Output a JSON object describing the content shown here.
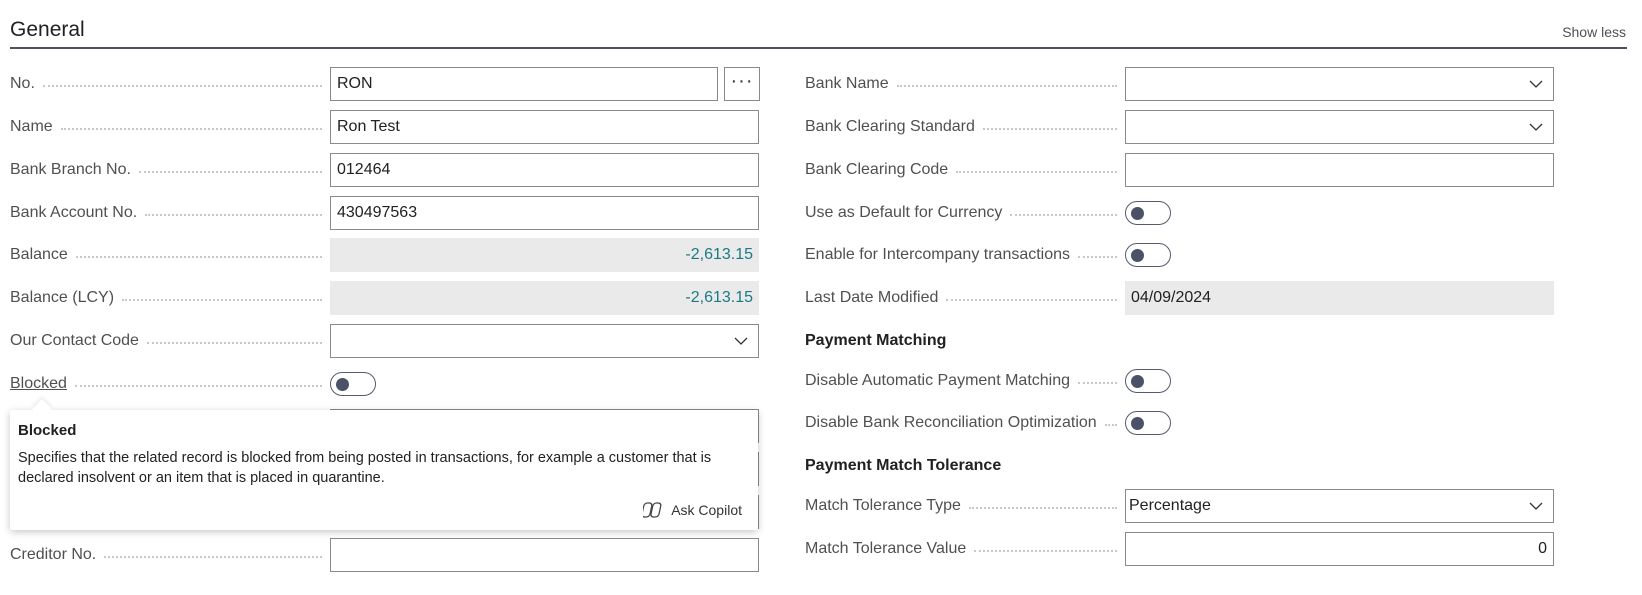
{
  "header": {
    "title": "General",
    "show_less": "Show less"
  },
  "left": {
    "no": {
      "label": "No.",
      "value": "RON",
      "assist": "···"
    },
    "name": {
      "label": "Name",
      "value": "Ron Test"
    },
    "branch": {
      "label": "Bank Branch No.",
      "value": "012464"
    },
    "account": {
      "label": "Bank Account No.",
      "value": "430497563"
    },
    "balance": {
      "label": "Balance",
      "value": "-2,613.15"
    },
    "balance_lcy": {
      "label": "Balance (LCY)",
      "value": "-2,613.15"
    },
    "contact": {
      "label": "Our Contact Code",
      "value": ""
    },
    "blocked": {
      "label": "Blocked",
      "value": false
    },
    "creditor": {
      "label": "Creditor No.",
      "value": ""
    }
  },
  "right": {
    "bank_name": {
      "label": "Bank Name",
      "value": ""
    },
    "clearing_standard": {
      "label": "Bank Clearing Standard",
      "value": ""
    },
    "clearing_code": {
      "label": "Bank Clearing Code",
      "value": ""
    },
    "default_currency": {
      "label": "Use as Default for Currency",
      "value": false
    },
    "intercompany": {
      "label": "Enable for Intercompany transactions",
      "value": false
    },
    "last_modified": {
      "label": "Last Date Modified",
      "value": "04/09/2024"
    },
    "payment_matching": "Payment Matching",
    "disable_auto": {
      "label": "Disable Automatic Payment Matching",
      "value": false
    },
    "disable_recon": {
      "label": "Disable Bank Reconciliation Optimization",
      "value": false
    },
    "payment_tolerance": "Payment Match Tolerance",
    "tol_type": {
      "label": "Match Tolerance Type",
      "value": "Percentage"
    },
    "tol_value": {
      "label": "Match Tolerance Value",
      "value": "0"
    }
  },
  "tooltip": {
    "title": "Blocked",
    "body": "Specifies that the related record is blocked from being posted in transactions, for example a customer that is declared insolvent or an item that is placed in quarantine.",
    "copilot": "Ask Copilot"
  },
  "colors": {
    "accent_numeric": "#1a7a85",
    "header_rule": "#4d5166"
  },
  "icons": {
    "dropdown": "chevron-down-icon",
    "copilot": "copilot-icon",
    "toggle_knob": "toggle-off"
  }
}
